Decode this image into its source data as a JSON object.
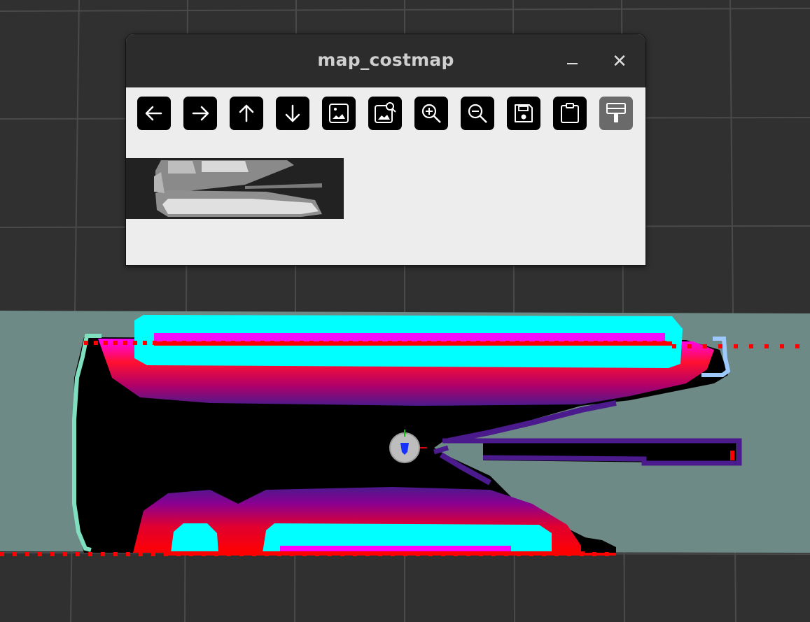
{
  "rviz_view": {
    "background": "#303030",
    "grid_line_color": "#4a4a4a",
    "layers": [
      "map",
      "costmap",
      "laser_scan",
      "robot_footprint",
      "axes"
    ],
    "colors": {
      "unknown_space": "#6e8a86",
      "free_space": "#000000",
      "lethal": "#00ffff",
      "inscribed": "#ff00ff",
      "cost_high": "#ff0000",
      "cost_low": "#4b1a8c",
      "laser_points": "#ff0000",
      "footprint_outline": "#7fdfbf",
      "robot_body": "#c0c0c0",
      "robot_marker": "#1530ff"
    }
  },
  "window": {
    "title": "map_costmap",
    "minimize_icon": "minimize-icon",
    "close_label": "✕"
  },
  "toolbar": {
    "buttons": [
      {
        "name": "left-arrow-icon",
        "enabled": true
      },
      {
        "name": "right-arrow-icon",
        "enabled": true
      },
      {
        "name": "up-arrow-icon",
        "enabled": true
      },
      {
        "name": "down-arrow-icon",
        "enabled": true
      },
      {
        "name": "image-icon",
        "enabled": true
      },
      {
        "name": "image-search-icon",
        "enabled": true
      },
      {
        "name": "zoom-in-icon",
        "enabled": true
      },
      {
        "name": "zoom-out-icon",
        "enabled": true
      },
      {
        "name": "save-icon",
        "enabled": true
      },
      {
        "name": "clipboard-icon",
        "enabled": true
      },
      {
        "name": "paint-brush-icon",
        "enabled": false
      }
    ]
  },
  "preview": {
    "description_icon": "grayscale-costmap-thumbnail",
    "background": "#222222"
  }
}
